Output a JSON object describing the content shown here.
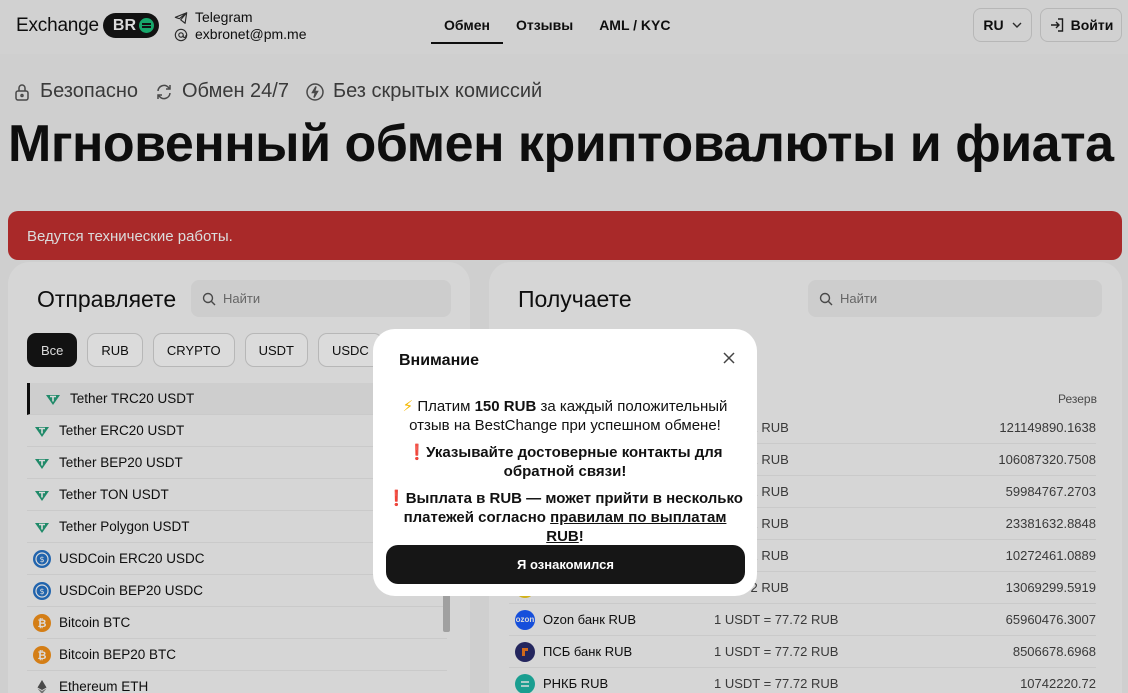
{
  "header": {
    "logo_text": "Exchange",
    "logo_pill": "BR",
    "telegram": "Telegram",
    "email": "exbronet@pm.me",
    "nav": [
      {
        "label": "Обмен"
      },
      {
        "label": "Отзывы"
      },
      {
        "label": "AML / KYC"
      }
    ],
    "lang": "RU",
    "login": "Войти"
  },
  "hero": {
    "features": [
      "Безопасно",
      "Обмен 24/7",
      "Без скрытых комиссий"
    ],
    "title": "Мгновенный обмен криптовалюты и фиата"
  },
  "alert": "Ведутся технические работы.",
  "send": {
    "title": "Отправляете",
    "search_placeholder": "Найти",
    "chips": [
      "Все",
      "RUB",
      "CRYPTO",
      "USDT",
      "USDC"
    ],
    "items": [
      "Tether TRC20 USDT",
      "Tether ERC20 USDT",
      "Tether BEP20 USDT",
      "Tether TON USDT",
      "Tether Polygon USDT",
      "USDCoin ERC20 USDC",
      "USDCoin BEP20 USDC",
      "Bitcoin BTC",
      "Bitcoin BEP20 BTC",
      "Ethereum ETH"
    ]
  },
  "receive": {
    "title": "Получаете",
    "search_placeholder": "Найти",
    "reserve_header": "Резерв",
    "rows": [
      {
        "name": "",
        "rate": "= 77.72 RUB",
        "reserve": "121149890.1638"
      },
      {
        "name": "",
        "rate": "= 77.72 RUB",
        "reserve": "106087320.7508"
      },
      {
        "name": "",
        "rate": "= 77.72 RUB",
        "reserve": "59984767.2703"
      },
      {
        "name": "",
        "rate": "= 77.72 RUB",
        "reserve": "23381632.8848"
      },
      {
        "name": "",
        "rate": "= 77.72 RUB",
        "reserve": "10272461.0889"
      },
      {
        "name": "",
        "rate": "= 77.72 RUB",
        "reserve": "13069299.5919"
      },
      {
        "name": "Ozon банк RUB",
        "rate": "1 USDT = 77.72 RUB",
        "reserve": "65960476.3007"
      },
      {
        "name": "ПСБ банк RUB",
        "rate": "1 USDT = 77.72 RUB",
        "reserve": "8506678.6968"
      },
      {
        "name": "РНКБ RUB",
        "rate": "1 USDT = 77.72 RUB",
        "reserve": "10742220.72"
      }
    ]
  },
  "modal": {
    "title": "Внимание",
    "p1_pre": "Платим ",
    "p1_bold": "150 RUB",
    "p1_post": " за каждый положительный отзыв на BestChange при успешном обмене!",
    "p2": "Указывайте достоверные контакты для обратной связи!",
    "p3_pre": "Выплата в RUB — может прийти в несколько платежей согласно ",
    "p3_link": "правилам по выплатам RUB",
    "p3_post": "!",
    "button": "Я ознакомился"
  },
  "colors": {
    "alert": "#c53030",
    "tether": "#26a17b",
    "usdc": "#2775ca",
    "bitcoin": "#f7931a"
  }
}
